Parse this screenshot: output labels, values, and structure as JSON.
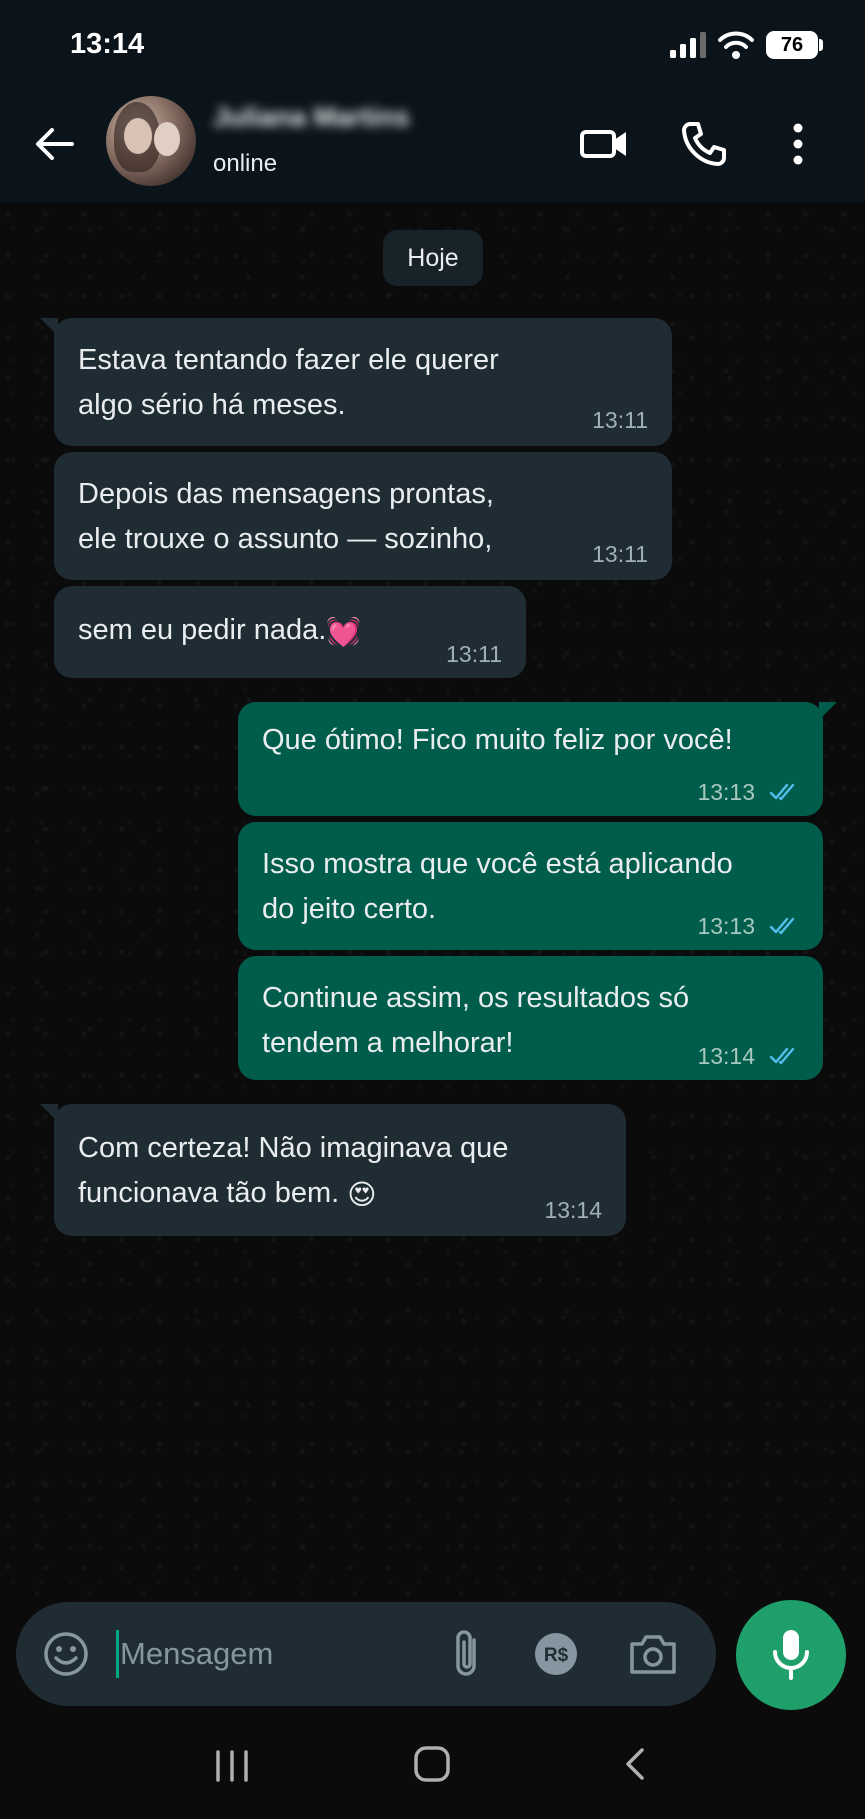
{
  "status_bar": {
    "time": "13:14",
    "battery": "76"
  },
  "header": {
    "contact_name": "Juliana Martins",
    "contact_status": "online"
  },
  "date_chip": "Hoje",
  "messages": [
    {
      "line1": "Estava tentando fazer ele querer",
      "line2": "algo sério há meses.",
      "time": "13:11"
    },
    {
      "line1": "Depois das mensagens prontas,",
      "line2": "ele trouxe o assunto — sozinho,",
      "time": "13:11"
    },
    {
      "line1": "sem eu pedir nada.",
      "emoji": "💓",
      "time": "13:11"
    },
    {
      "line1": "Que ótimo! Fico muito feliz por você!",
      "time": "13:13"
    },
    {
      "line1": "Isso mostra que você está aplicando",
      "line2": "do jeito certo.",
      "time": "13:13"
    },
    {
      "line1": "Continue assim, os resultados só",
      "line2": "tendem a melhorar!",
      "time": "13:14"
    },
    {
      "line1": "Com certeza! Não imaginava que",
      "line2": "funcionava tão bem.",
      "emoji": "😍",
      "time": "13:14"
    }
  ],
  "input": {
    "placeholder": "Mensagem"
  },
  "colors": {
    "incoming_bubble": "#1f2c33",
    "outgoing_bubble": "#005c4b",
    "accent": "#1fa06a",
    "read_ticks": "#53bdeb"
  },
  "icons": [
    "back-arrow-icon",
    "video-call-icon",
    "phone-icon",
    "more-vertical-icon",
    "emoji-icon",
    "paperclip-icon",
    "payment-icon",
    "camera-icon",
    "microphone-icon"
  ]
}
